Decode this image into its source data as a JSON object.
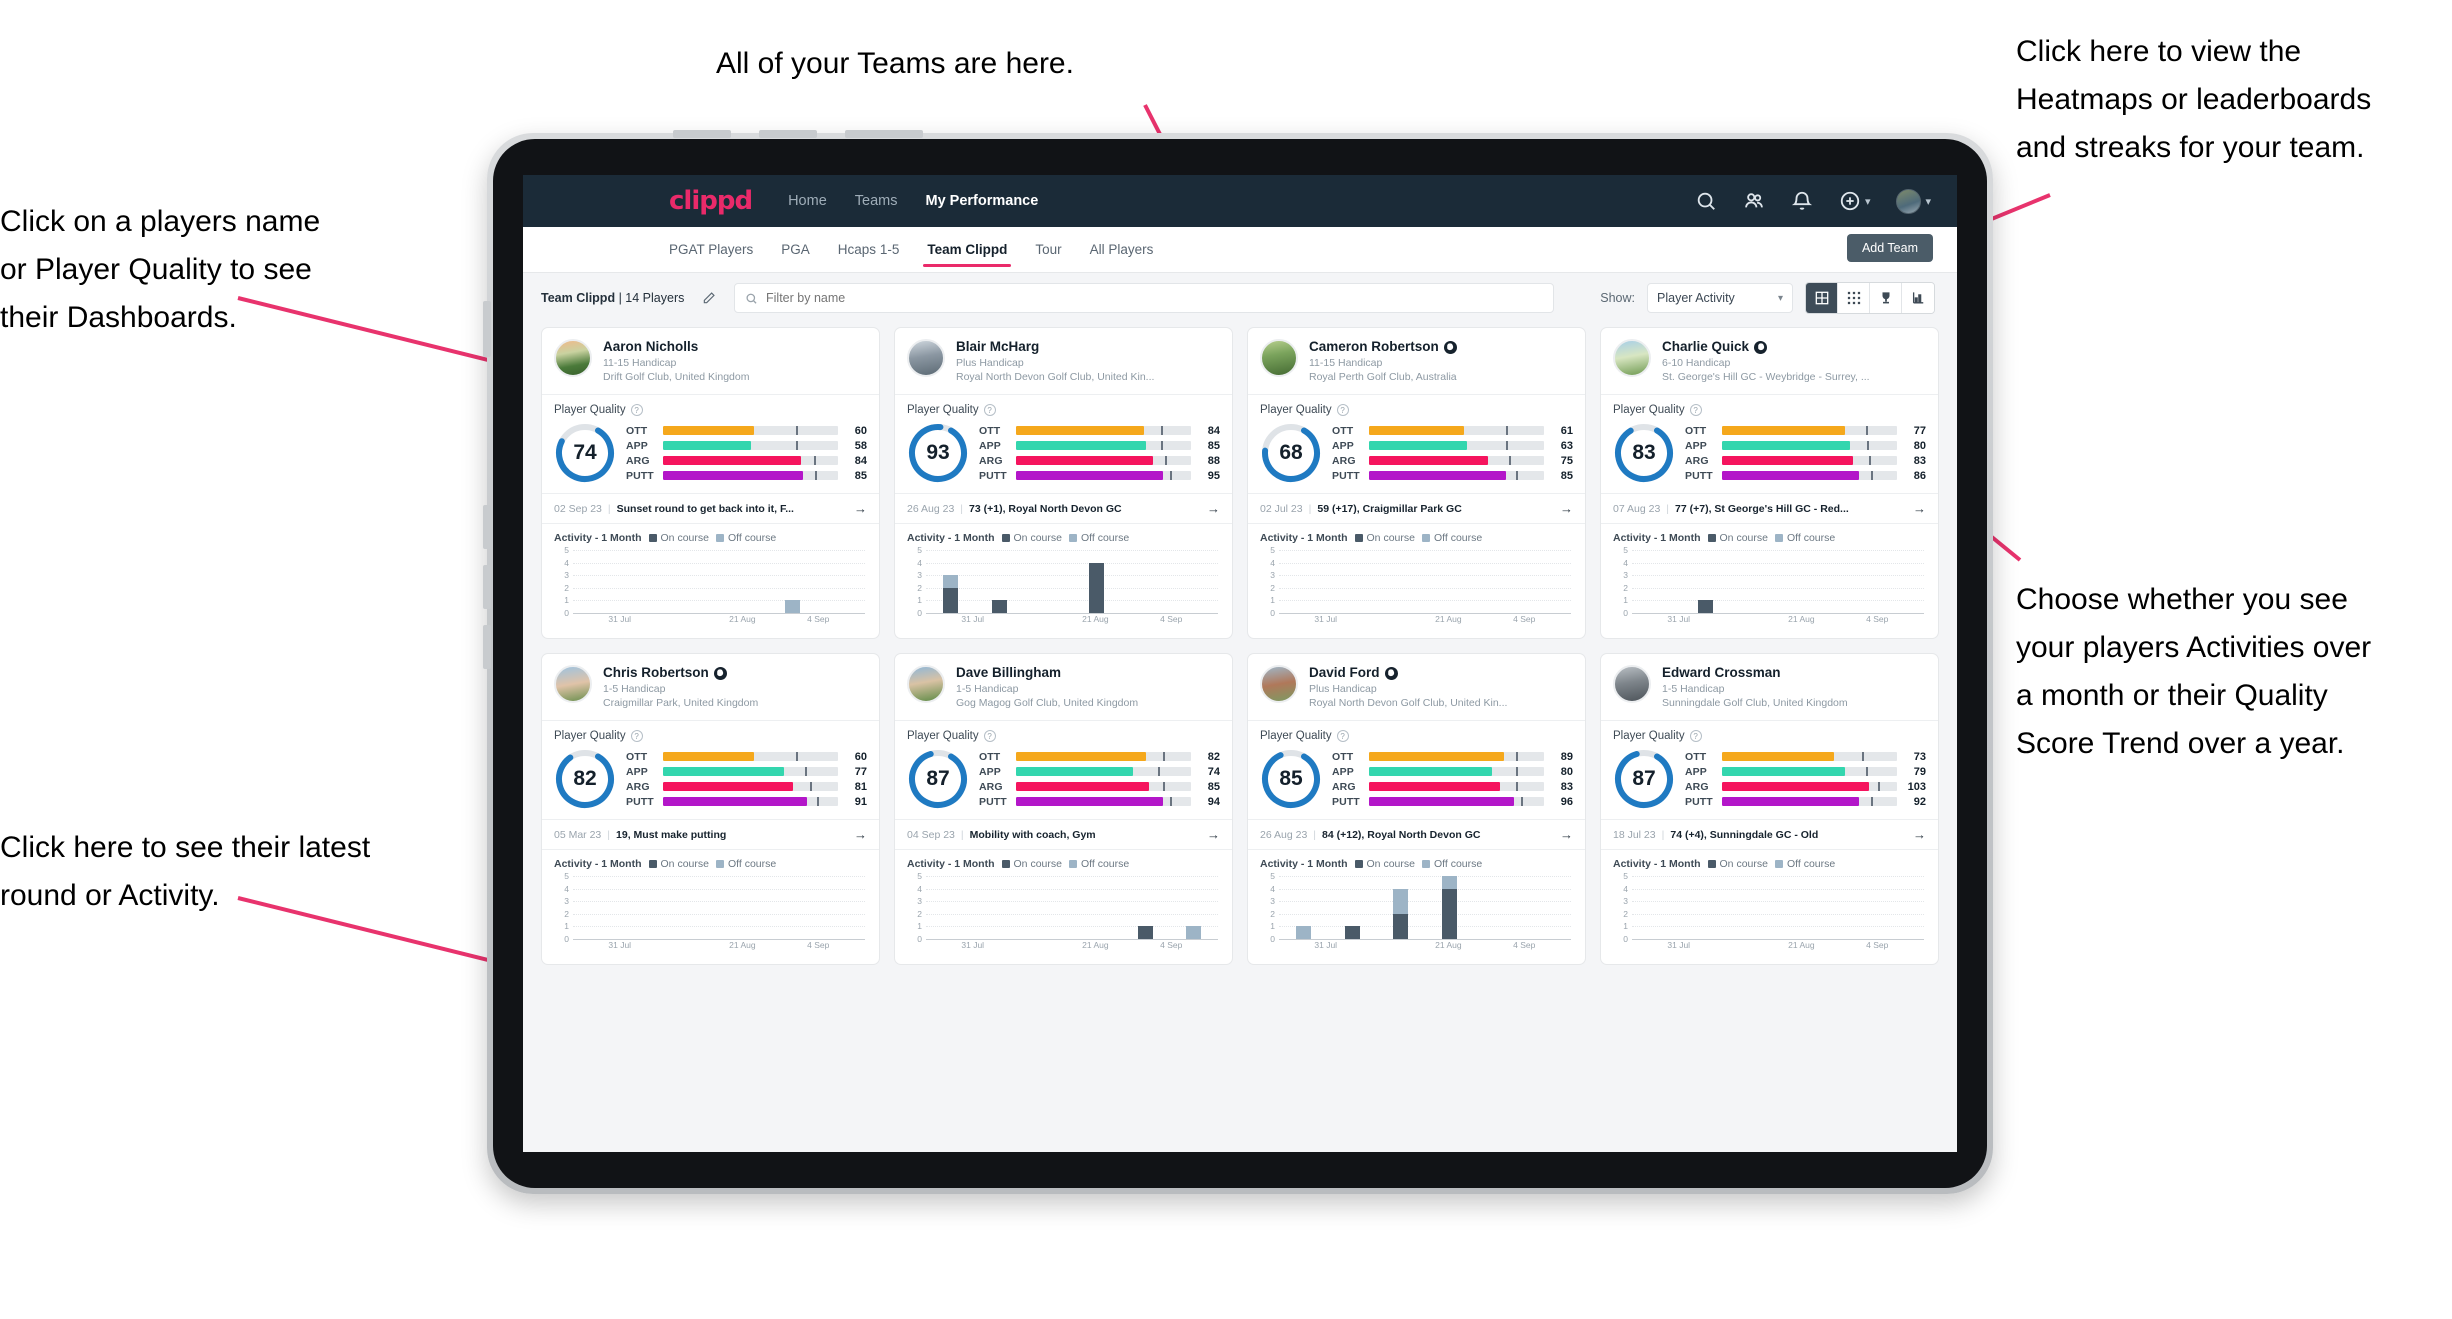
{
  "annotations": [
    {
      "id": "a-teams",
      "text": "All of your Teams are here."
    },
    {
      "id": "a-heatmap",
      "text": "Click here to view the\nHeatmaps or leaderboards\nand streaks for your team."
    },
    {
      "id": "a-names",
      "text": "Click on a players name\nor Player Quality to see\ntheir Dashboards."
    },
    {
      "id": "a-choose",
      "text": "Choose whether you see\nyour players Activities over\na month or their Quality\nScore Trend over a year."
    },
    {
      "id": "a-round",
      "text": "Click here to see their latest\nround or Activity."
    }
  ],
  "navbar": {
    "brand": "clippd",
    "links": [
      {
        "label": "Home",
        "active": false
      },
      {
        "label": "Teams",
        "active": false
      },
      {
        "label": "My Performance",
        "active": true
      }
    ],
    "icons": [
      "search-icon",
      "people-icon",
      "bell-icon",
      "plus-circle-icon",
      "avatar"
    ]
  },
  "subnav": {
    "tabs": [
      {
        "label": "PGAT Players",
        "active": false
      },
      {
        "label": "PGA",
        "active": false
      },
      {
        "label": "Hcaps 1-5",
        "active": false
      },
      {
        "label": "Team Clippd",
        "active": true
      },
      {
        "label": "Tour",
        "active": false
      },
      {
        "label": "All Players",
        "active": false
      }
    ],
    "add_team_label": "Add Team"
  },
  "toolbar": {
    "team_name": "Team Clippd",
    "player_count": "| 14 Players",
    "edit_icon": "pencil-icon",
    "search_placeholder": "Filter by name",
    "search_value": "",
    "show_label": "Show:",
    "show_selected": "Player Activity",
    "show_options": [
      "Player Activity",
      "Quality Score Trend"
    ],
    "views": [
      {
        "name": "card-view",
        "active": true
      },
      {
        "name": "grid-view",
        "active": false
      },
      {
        "name": "trophy-view",
        "active": false
      },
      {
        "name": "streak-view",
        "active": false
      }
    ]
  },
  "colors": {
    "brand_pink": "#ea2a6a",
    "navy": "#1b2b38",
    "donut_blue": "#1f7ac2",
    "ott": "#f5a81c",
    "app": "#33d6ae",
    "arg": "#f5145e",
    "putt": "#b316c9",
    "on_course": "#4a5a68",
    "off_course": "#9db4c6"
  },
  "quality_section": {
    "title": "Player Quality",
    "help_icon": "question-circle-icon"
  },
  "activity_section": {
    "title": "Activity - 1 Month",
    "legend": [
      {
        "label": "On course",
        "color": "#4a5a68"
      },
      {
        "label": "Off course",
        "color": "#9db4c6"
      }
    ],
    "y_ticks": [
      5,
      4,
      3,
      2,
      1,
      0
    ],
    "x_ticks": [
      "31 Jul",
      "21 Aug",
      "4 Sep"
    ],
    "y_max": 5
  },
  "players": [
    {
      "name": "Aaron Nicholls",
      "verified": false,
      "handicap": "11-15 Handicap",
      "club": "Drift Golf Club, United Kingdom",
      "quality_score": 74,
      "metrics": [
        {
          "label": "OTT",
          "value": 60,
          "color": "#f5a81c",
          "fill_pct": 52,
          "tick_pct": 76
        },
        {
          "label": "APP",
          "value": 58,
          "color": "#33d6ae",
          "fill_pct": 50,
          "tick_pct": 76
        },
        {
          "label": "ARG",
          "value": 84,
          "color": "#f5145e",
          "fill_pct": 79,
          "tick_pct": 86
        },
        {
          "label": "PUTT",
          "value": 85,
          "color": "#b316c9",
          "fill_pct": 80,
          "tick_pct": 87
        }
      ],
      "round": {
        "date": "02 Sep 23",
        "text": "Sunset round to get back into it, F..."
      },
      "chart_data": {
        "type": "bar",
        "title": "Activity - 1 Month",
        "categories": [
          "31 Jul",
          "7 Aug",
          "14 Aug",
          "21 Aug",
          "28 Aug",
          "4 Sep"
        ],
        "series": [
          {
            "name": "On course",
            "values": [
              0,
              0,
              0,
              0,
              0,
              0
            ]
          },
          {
            "name": "Off course",
            "values": [
              0,
              0,
              0,
              0,
              1,
              0
            ]
          }
        ],
        "ylim": [
          0,
          5
        ]
      }
    },
    {
      "name": "Blair McHarg",
      "verified": false,
      "handicap": "Plus Handicap",
      "club": "Royal North Devon Golf Club, United Kin...",
      "quality_score": 93,
      "metrics": [
        {
          "label": "OTT",
          "value": 84,
          "color": "#f5a81c",
          "fill_pct": 73,
          "tick_pct": 83
        },
        {
          "label": "APP",
          "value": 85,
          "color": "#33d6ae",
          "fill_pct": 74,
          "tick_pct": 83
        },
        {
          "label": "ARG",
          "value": 88,
          "color": "#f5145e",
          "fill_pct": 78,
          "tick_pct": 85
        },
        {
          "label": "PUTT",
          "value": 95,
          "color": "#b316c9",
          "fill_pct": 84,
          "tick_pct": 88
        }
      ],
      "round": {
        "date": "26 Aug 23",
        "text": "73 (+1), Royal North Devon GC"
      },
      "chart_data": {
        "type": "bar",
        "title": "Activity - 1 Month",
        "categories": [
          "31 Jul",
          "7 Aug",
          "14 Aug",
          "21 Aug",
          "28 Aug",
          "4 Sep"
        ],
        "series": [
          {
            "name": "On course",
            "values": [
              2,
              1,
              0,
              4,
              0,
              0
            ]
          },
          {
            "name": "Off course",
            "values": [
              1,
              0,
              0,
              0,
              0,
              0
            ]
          }
        ],
        "ylim": [
          0,
          5
        ]
      }
    },
    {
      "name": "Cameron Robertson",
      "verified": true,
      "handicap": "11-15 Handicap",
      "club": "Royal Perth Golf Club, Australia",
      "quality_score": 68,
      "metrics": [
        {
          "label": "OTT",
          "value": 61,
          "color": "#f5a81c",
          "fill_pct": 54,
          "tick_pct": 78
        },
        {
          "label": "APP",
          "value": 63,
          "color": "#33d6ae",
          "fill_pct": 56,
          "tick_pct": 78
        },
        {
          "label": "ARG",
          "value": 75,
          "color": "#f5145e",
          "fill_pct": 68,
          "tick_pct": 80
        },
        {
          "label": "PUTT",
          "value": 85,
          "color": "#b316c9",
          "fill_pct": 78,
          "tick_pct": 84
        }
      ],
      "round": {
        "date": "02 Jul 23",
        "text": "59 (+17), Craigmillar Park GC"
      },
      "chart_data": {
        "type": "bar",
        "title": "Activity - 1 Month",
        "categories": [
          "31 Jul",
          "7 Aug",
          "14 Aug",
          "21 Aug",
          "28 Aug",
          "4 Sep"
        ],
        "series": [
          {
            "name": "On course",
            "values": [
              0,
              0,
              0,
              0,
              0,
              0
            ]
          },
          {
            "name": "Off course",
            "values": [
              0,
              0,
              0,
              0,
              0,
              0
            ]
          }
        ],
        "ylim": [
          0,
          5
        ]
      }
    },
    {
      "name": "Charlie Quick",
      "verified": true,
      "handicap": "6-10 Handicap",
      "club": "St. George's Hill GC - Weybridge - Surrey, ...",
      "quality_score": 83,
      "metrics": [
        {
          "label": "OTT",
          "value": 77,
          "color": "#f5a81c",
          "fill_pct": 70,
          "tick_pct": 82
        },
        {
          "label": "APP",
          "value": 80,
          "color": "#33d6ae",
          "fill_pct": 73,
          "tick_pct": 83
        },
        {
          "label": "ARG",
          "value": 83,
          "color": "#f5145e",
          "fill_pct": 75,
          "tick_pct": 84
        },
        {
          "label": "PUTT",
          "value": 86,
          "color": "#b316c9",
          "fill_pct": 78,
          "tick_pct": 85
        }
      ],
      "round": {
        "date": "07 Aug 23",
        "text": "77 (+7), St George's Hill GC - Red..."
      },
      "chart_data": {
        "type": "bar",
        "title": "Activity - 1 Month",
        "categories": [
          "31 Jul",
          "7 Aug",
          "14 Aug",
          "21 Aug",
          "28 Aug",
          "4 Sep"
        ],
        "series": [
          {
            "name": "On course",
            "values": [
              0,
              1,
              0,
              0,
              0,
              0
            ]
          },
          {
            "name": "Off course",
            "values": [
              0,
              0,
              0,
              0,
              0,
              0
            ]
          }
        ],
        "ylim": [
          0,
          5
        ]
      }
    },
    {
      "name": "Chris Robertson",
      "verified": true,
      "handicap": "1-5 Handicap",
      "club": "Craigmillar Park, United Kingdom",
      "quality_score": 82,
      "metrics": [
        {
          "label": "OTT",
          "value": 60,
          "color": "#f5a81c",
          "fill_pct": 52,
          "tick_pct": 76
        },
        {
          "label": "APP",
          "value": 77,
          "color": "#33d6ae",
          "fill_pct": 69,
          "tick_pct": 81
        },
        {
          "label": "ARG",
          "value": 81,
          "color": "#f5145e",
          "fill_pct": 74,
          "tick_pct": 84
        },
        {
          "label": "PUTT",
          "value": 91,
          "color": "#b316c9",
          "fill_pct": 82,
          "tick_pct": 88
        }
      ],
      "round": {
        "date": "05 Mar 23",
        "text": "19, Must make putting"
      },
      "chart_data": {
        "type": "bar",
        "title": "Activity - 1 Month",
        "categories": [
          "31 Jul",
          "7 Aug",
          "14 Aug",
          "21 Aug",
          "28 Aug",
          "4 Sep"
        ],
        "series": [
          {
            "name": "On course",
            "values": [
              0,
              0,
              0,
              0,
              0,
              0
            ]
          },
          {
            "name": "Off course",
            "values": [
              0,
              0,
              0,
              0,
              0,
              0
            ]
          }
        ],
        "ylim": [
          0,
          5
        ]
      }
    },
    {
      "name": "Dave Billingham",
      "verified": false,
      "handicap": "1-5 Handicap",
      "club": "Gog Magog Golf Club, United Kingdom",
      "quality_score": 87,
      "metrics": [
        {
          "label": "OTT",
          "value": 82,
          "color": "#f5a81c",
          "fill_pct": 74,
          "tick_pct": 84
        },
        {
          "label": "APP",
          "value": 74,
          "color": "#33d6ae",
          "fill_pct": 67,
          "tick_pct": 81
        },
        {
          "label": "ARG",
          "value": 85,
          "color": "#f5145e",
          "fill_pct": 76,
          "tick_pct": 84
        },
        {
          "label": "PUTT",
          "value": 94,
          "color": "#b316c9",
          "fill_pct": 84,
          "tick_pct": 88
        }
      ],
      "round": {
        "date": "04 Sep 23",
        "text": "Mobility with coach, Gym"
      },
      "chart_data": {
        "type": "bar",
        "title": "Activity - 1 Month",
        "categories": [
          "31 Jul",
          "7 Aug",
          "14 Aug",
          "21 Aug",
          "28 Aug",
          "4 Sep"
        ],
        "series": [
          {
            "name": "On course",
            "values": [
              0,
              0,
              0,
              0,
              1,
              0
            ]
          },
          {
            "name": "Off course",
            "values": [
              0,
              0,
              0,
              0,
              0,
              1
            ]
          }
        ],
        "ylim": [
          0,
          5
        ]
      }
    },
    {
      "name": "David Ford",
      "verified": true,
      "handicap": "Plus Handicap",
      "club": "Royal North Devon Golf Club, United Kin...",
      "quality_score": 85,
      "metrics": [
        {
          "label": "OTT",
          "value": 89,
          "color": "#f5a81c",
          "fill_pct": 77,
          "tick_pct": 84
        },
        {
          "label": "APP",
          "value": 80,
          "color": "#33d6ae",
          "fill_pct": 70,
          "tick_pct": 84
        },
        {
          "label": "ARG",
          "value": 83,
          "color": "#f5145e",
          "fill_pct": 75,
          "tick_pct": 84
        },
        {
          "label": "PUTT",
          "value": 96,
          "color": "#b316c9",
          "fill_pct": 83,
          "tick_pct": 87
        }
      ],
      "round": {
        "date": "26 Aug 23",
        "text": "84 (+12), Royal North Devon GC"
      },
      "chart_data": {
        "type": "bar",
        "title": "Activity - 1 Month",
        "categories": [
          "31 Jul",
          "7 Aug",
          "14 Aug",
          "21 Aug",
          "28 Aug",
          "4 Sep"
        ],
        "series": [
          {
            "name": "On course",
            "values": [
              0,
              1,
              2,
              4,
              0,
              0
            ]
          },
          {
            "name": "Off course",
            "values": [
              1,
              0,
              2,
              1,
              0,
              0
            ]
          }
        ],
        "ylim": [
          0,
          5
        ]
      }
    },
    {
      "name": "Edward Crossman",
      "verified": false,
      "handicap": "1-5 Handicap",
      "club": "Sunningdale Golf Club, United Kingdom",
      "quality_score": 87,
      "metrics": [
        {
          "label": "OTT",
          "value": 73,
          "color": "#f5a81c",
          "fill_pct": 64,
          "tick_pct": 80
        },
        {
          "label": "APP",
          "value": 79,
          "color": "#33d6ae",
          "fill_pct": 70,
          "tick_pct": 82
        },
        {
          "label": "ARG",
          "value": 103,
          "color": "#f5145e",
          "fill_pct": 84,
          "tick_pct": 89
        },
        {
          "label": "PUTT",
          "value": 92,
          "color": "#b316c9",
          "fill_pct": 78,
          "tick_pct": 85
        }
      ],
      "round": {
        "date": "18 Jul 23",
        "text": "74 (+4), Sunningdale GC - Old"
      },
      "chart_data": {
        "type": "bar",
        "title": "Activity - 1 Month",
        "categories": [
          "31 Jul",
          "7 Aug",
          "14 Aug",
          "21 Aug",
          "28 Aug",
          "4 Sep"
        ],
        "series": [
          {
            "name": "On course",
            "values": [
              0,
              0,
              0,
              0,
              0,
              0
            ]
          },
          {
            "name": "Off course",
            "values": [
              0,
              0,
              0,
              0,
              0,
              0
            ]
          }
        ],
        "ylim": [
          0,
          5
        ]
      }
    }
  ]
}
